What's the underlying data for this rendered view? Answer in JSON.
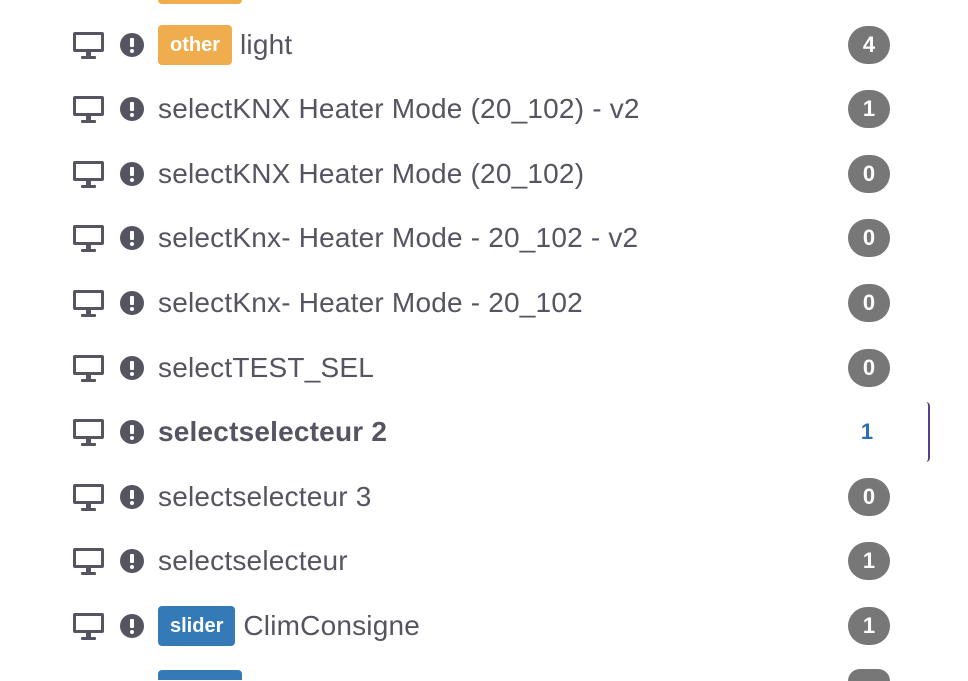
{
  "colors": {
    "tag_other": "#f0ad4e",
    "tag_slider": "#337ab7",
    "badge_bg": "#777777",
    "badge_text_active": "#2e6db4",
    "icon_gray": "#555461"
  },
  "rows": [
    {
      "tag": "other",
      "name": "light",
      "count": "4",
      "bold": false,
      "active": false
    },
    {
      "tag": "",
      "name": "selectKNX Heater Mode (20_102) - v2",
      "count": "1",
      "bold": false,
      "active": false
    },
    {
      "tag": "",
      "name": "selectKNX Heater Mode (20_102)",
      "count": "0",
      "bold": false,
      "active": false
    },
    {
      "tag": "",
      "name": "selectKnx- Heater Mode - 20_102 - v2",
      "count": "0",
      "bold": false,
      "active": false
    },
    {
      "tag": "",
      "name": "selectKnx- Heater Mode - 20_102",
      "count": "0",
      "bold": false,
      "active": false
    },
    {
      "tag": "",
      "name": "selectTEST_SEL",
      "count": "0",
      "bold": false,
      "active": false
    },
    {
      "tag": "",
      "name": "selectselecteur 2",
      "count": "1",
      "bold": true,
      "active": true
    },
    {
      "tag": "",
      "name": "selectselecteur 3",
      "count": "0",
      "bold": false,
      "active": false
    },
    {
      "tag": "",
      "name": "selectselecteur",
      "count": "1",
      "bold": false,
      "active": false
    },
    {
      "tag": "slider",
      "name": "ClimConsigne",
      "count": "1",
      "bold": false,
      "active": false
    }
  ],
  "icons": {
    "row_type": "desktop-monitor-icon",
    "row_status": "exclamation-circle-icon"
  }
}
